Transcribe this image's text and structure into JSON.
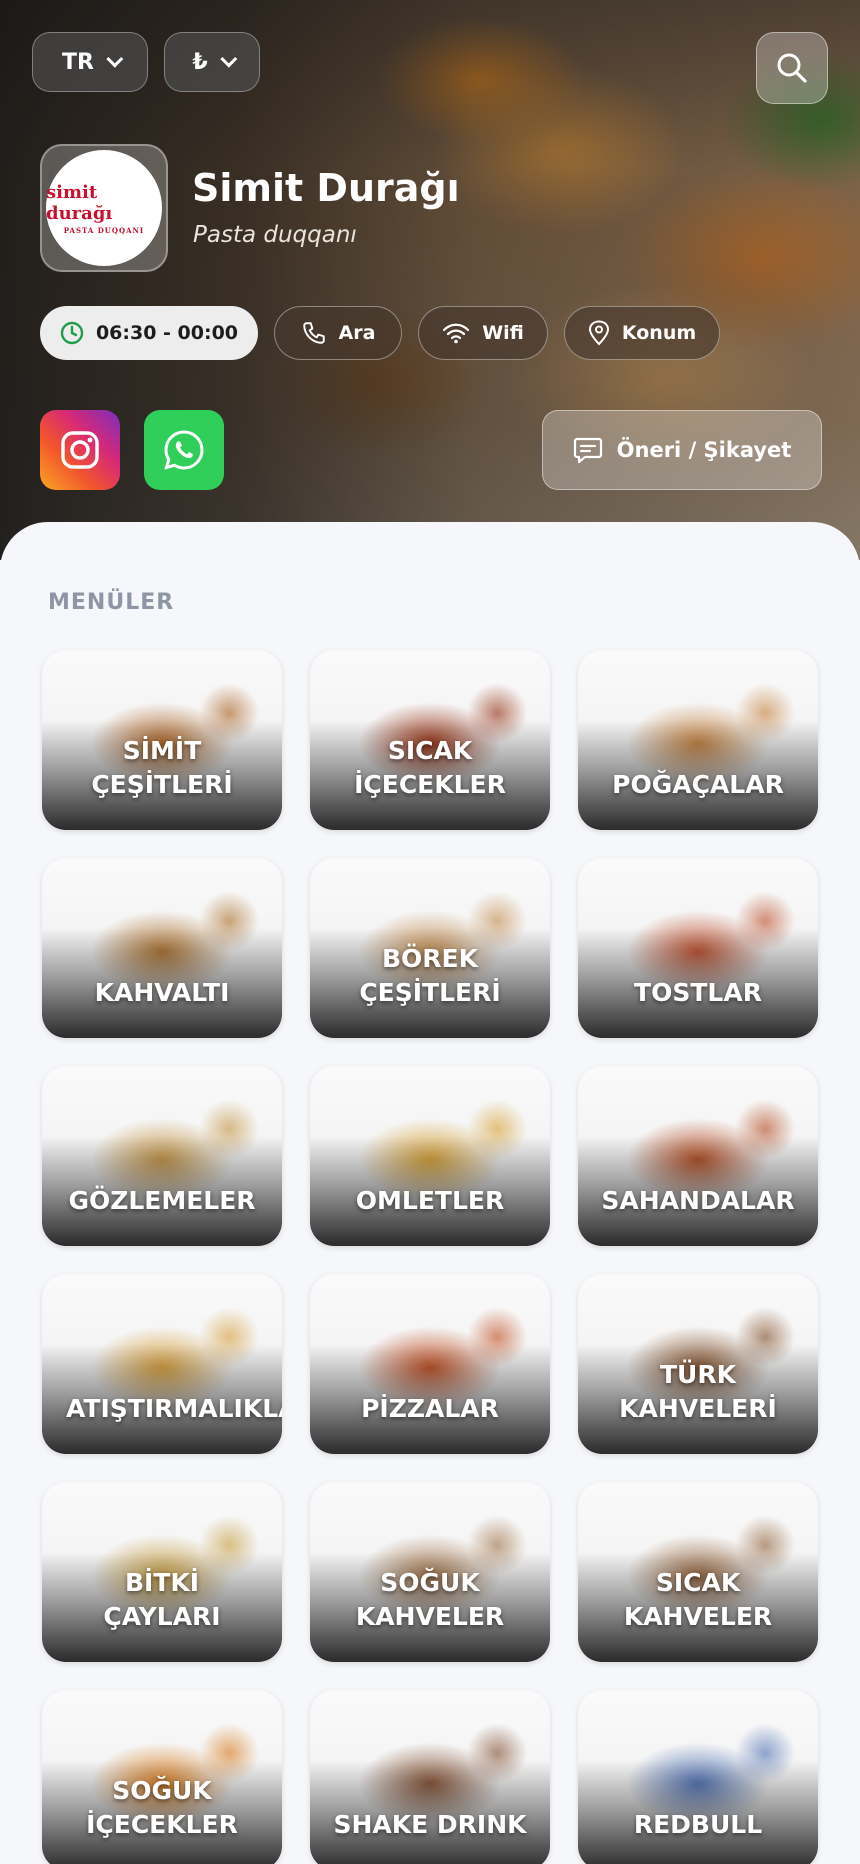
{
  "header": {
    "language": "TR",
    "currency_symbol": "₺",
    "business_name": "Simit Durağı",
    "business_type": "Pasta duqqanı",
    "logo": {
      "main": "simit durağı",
      "sub": "PASTA DUQQANI"
    },
    "hours": "06:30 - 00:00",
    "call_label": "Ara",
    "wifi_label": "Wifi",
    "location_label": "Konum",
    "feedback_label": "Öneri / Şikayet"
  },
  "menus": {
    "section_title": "MENÜLER",
    "items": [
      {
        "label": "SİMİT\nÇEŞİTLERİ",
        "tint": "#b06a2e"
      },
      {
        "label": "SICAK\nİÇECEKLER",
        "tint": "#9c3b1f"
      },
      {
        "label": "POĞAÇALAR",
        "tint": "#c8894a"
      },
      {
        "label": "KAHVALTI",
        "tint": "#b27a3a"
      },
      {
        "label": "BÖREK\nÇEŞİTLERİ",
        "tint": "#c6935a"
      },
      {
        "label": "TOSTLAR",
        "tint": "#c25a3a"
      },
      {
        "label": "GÖZLEMELER",
        "tint": "#c79a4e"
      },
      {
        "label": "OMLETLER",
        "tint": "#d8a640"
      },
      {
        "label": "SAHANDALAR",
        "tint": "#b8562e"
      },
      {
        "label": "ATIŞTIRMALIKLAR",
        "tint": "#d9a446"
      },
      {
        "label": "PİZZALAR",
        "tint": "#c4582e"
      },
      {
        "label": "TÜRK\nKAHVELERİ",
        "tint": "#8a5a36"
      },
      {
        "label": "BİTKİ\nÇAYLARI",
        "tint": "#c8a24a"
      },
      {
        "label": "SOĞUK\nKAHVELER",
        "tint": "#a57a52"
      },
      {
        "label": "SICAK\nKAHVELER",
        "tint": "#9a6d48"
      },
      {
        "label": "SOĞUK\nİÇECEKLER",
        "tint": "#d9822a"
      },
      {
        "label": "SHAKE DRINK",
        "tint": "#8a5a3e"
      },
      {
        "label": "REDBULL",
        "tint": "#5a7ab8"
      }
    ]
  }
}
